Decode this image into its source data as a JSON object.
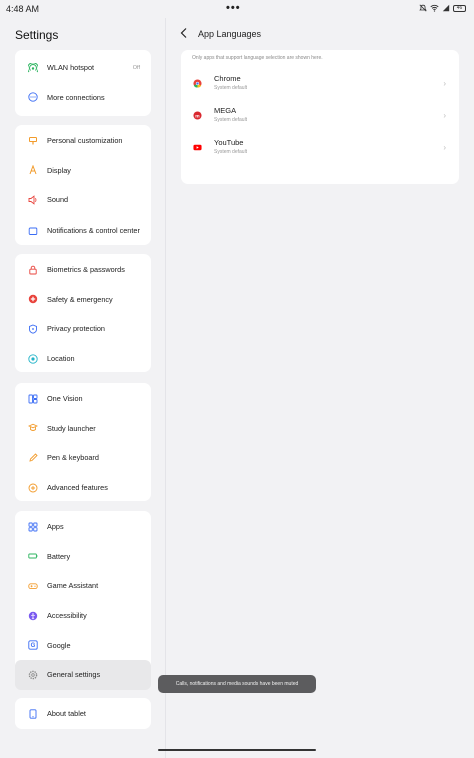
{
  "status_bar": {
    "time": "4:48 AM",
    "more": "•••",
    "battery": "46"
  },
  "settings": {
    "title": "Settings",
    "groups": [
      {
        "items": [
          {
            "label": "WLAN hotspot",
            "value": "Off",
            "icon": "hotspot-icon"
          },
          {
            "label": "More connections",
            "icon": "more-connections-icon"
          }
        ]
      },
      {
        "items": [
          {
            "label": "Personal customization",
            "icon": "customization-icon"
          },
          {
            "label": "Display",
            "icon": "display-icon"
          },
          {
            "label": "Sound",
            "icon": "sound-icon"
          },
          {
            "label": "Notifications & control center",
            "icon": "notifications-icon"
          }
        ]
      },
      {
        "items": [
          {
            "label": "Biometrics & passwords",
            "icon": "lock-icon"
          },
          {
            "label": "Safety & emergency",
            "icon": "emergency-icon"
          },
          {
            "label": "Privacy protection",
            "icon": "shield-icon"
          },
          {
            "label": "Location",
            "icon": "location-icon"
          }
        ]
      },
      {
        "items": [
          {
            "label": "One Vision",
            "icon": "one-vision-icon"
          },
          {
            "label": "Study launcher",
            "icon": "study-icon"
          },
          {
            "label": "Pen & keyboard",
            "icon": "pen-icon"
          },
          {
            "label": "Advanced features",
            "icon": "advanced-icon"
          }
        ]
      },
      {
        "items": [
          {
            "label": "Apps",
            "icon": "apps-icon"
          },
          {
            "label": "Battery",
            "icon": "battery-icon"
          },
          {
            "label": "Game Assistant",
            "icon": "game-icon"
          },
          {
            "label": "Accessibility",
            "icon": "accessibility-icon"
          },
          {
            "label": "Google",
            "icon": "google-icon"
          },
          {
            "label": "General settings",
            "icon": "gear-icon",
            "selected": true
          }
        ]
      },
      {
        "items": [
          {
            "label": "About tablet",
            "icon": "tablet-icon"
          }
        ]
      }
    ]
  },
  "app_languages": {
    "title": "App Languages",
    "note": "Only apps that support language selection are shown here.",
    "apps": [
      {
        "name": "Chrome",
        "status": "System default",
        "icon": "chrome-icon"
      },
      {
        "name": "MEGA",
        "status": "System default",
        "icon": "mega-icon"
      },
      {
        "name": "YouTube",
        "status": "System default",
        "icon": "youtube-icon"
      }
    ]
  },
  "toast": "Calls, notifications and media sounds have been muted",
  "colors": {
    "accent_blue": "#3a6cf4",
    "orange": "#f29b2b",
    "red": "#e8423b",
    "green": "#2cb45f",
    "cyan": "#22b3c8"
  }
}
